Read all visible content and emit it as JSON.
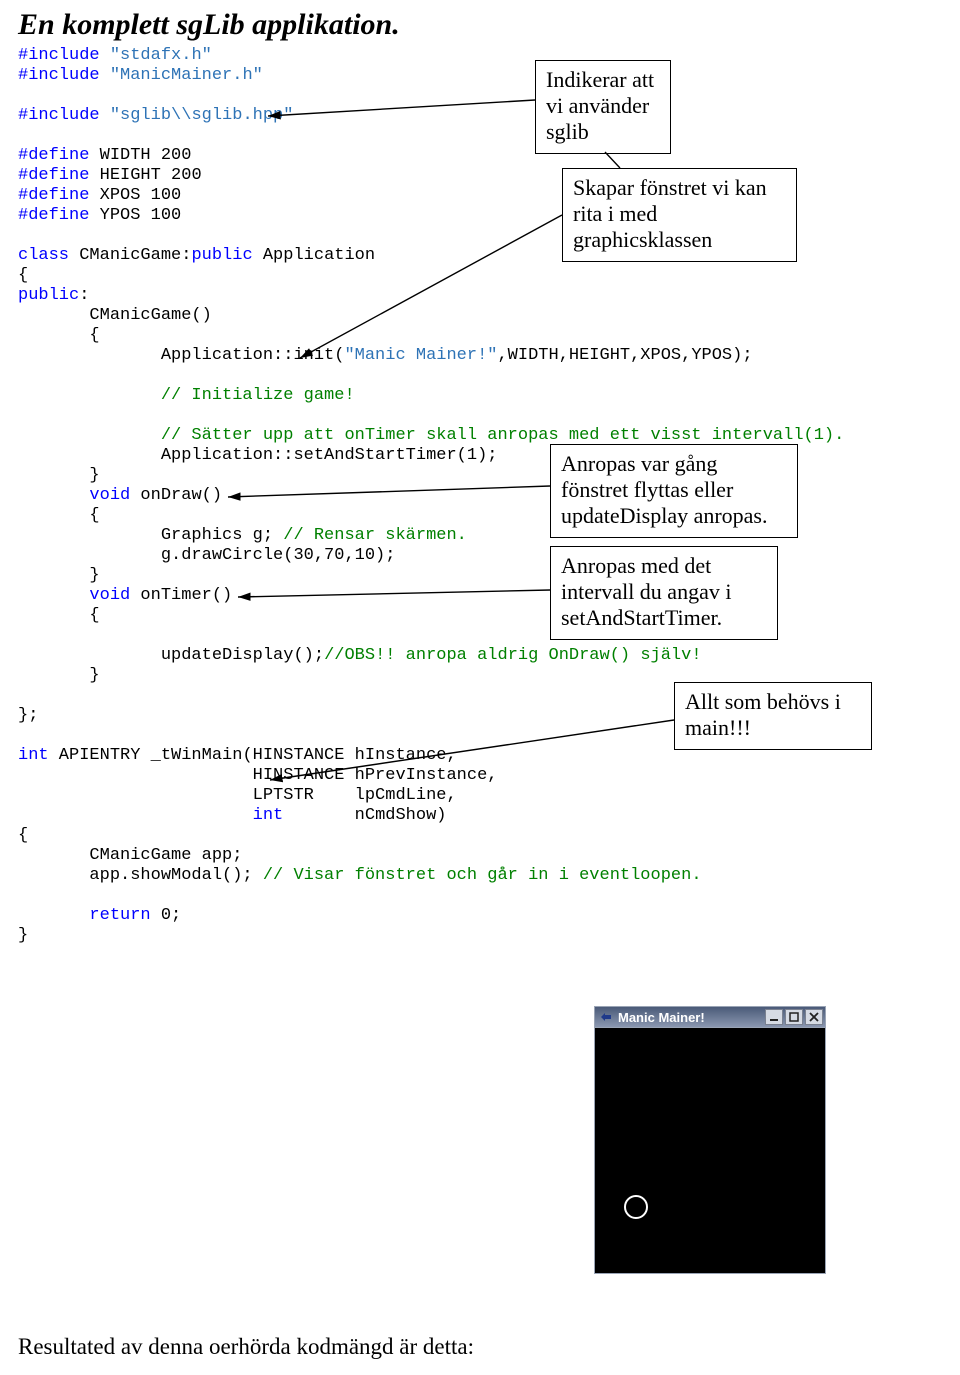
{
  "title": "En komplett sgLib applikation.",
  "code": {
    "l01a": "#include",
    "l01b": " \"stdafx.h\"",
    "l02a": "#include",
    "l02b": " \"ManicMainer.h\"",
    "l03": "",
    "l04a": "#include",
    "l04b": " \"sglib\\\\sglib.hpp\"",
    "l05": "",
    "l06a": "#define",
    "l06b": " WIDTH 200",
    "l07a": "#define",
    "l07b": " HEIGHT 200",
    "l08a": "#define",
    "l08b": " XPOS 100",
    "l09a": "#define",
    "l09b": " YPOS 100",
    "l10": "",
    "l11a": "class",
    "l11b": " CManicGame:",
    "l11c": "public",
    "l11d": " Application",
    "l12": "{",
    "l13a": "public",
    "l13b": ":",
    "l14": "       CManicGame()",
    "l15": "       {",
    "l16a": "              Application::init(",
    "l16b": "\"Manic Mainer!\"",
    "l16c": ",WIDTH,HEIGHT,XPOS,YPOS);",
    "l17": "",
    "l18": "              // Initialize game!",
    "l19": "",
    "l20": "              // Sätter upp att onTimer skall anropas med ett visst intervall(1).",
    "l21": "              Application::setAndStartTimer(1);",
    "l22": "       }",
    "l23a": "       ",
    "l23b": "void",
    "l23c": " onDraw()",
    "l24": "       {",
    "l25a": "              Graphics g; ",
    "l25b": "// Rensar skärmen.",
    "l26": "              g.drawCircle(30,70,10);",
    "l27": "       }",
    "l28a": "       ",
    "l28b": "void",
    "l28c": " onTimer()",
    "l29": "       {",
    "l30": "",
    "l31a": "              updateDisplay();",
    "l31b": "//OBS!! anropa aldrig OnDraw() själv!",
    "l32": "       }",
    "l33": "",
    "l34": "};",
    "l35": "",
    "l36a": "int",
    "l36b": " APIENTRY _tWinMain(HINSTANCE hInstance,",
    "l37": "                       HINSTANCE hPrevInstance,",
    "l38a": "                       LPTSTR    lpCmdLine,",
    "l39a": "                       ",
    "l39b": "int",
    "l39c": "       nCmdShow)",
    "l40": "{",
    "l41": "       CManicGame app;",
    "l42a": "       app.showModal(); ",
    "l42b": "// Visar fönstret och går in i eventloopen.",
    "l43": "",
    "l44a": "       ",
    "l44b": "return",
    "l44c": " 0;",
    "l45": "}"
  },
  "callouts": {
    "c1": "Indikerar att\nvi använder\nsglib",
    "c2": "Skapar fönstret vi kan\nrita i med\ngraphicsklassen",
    "c3": "Anropas var gång\nfönstret flyttas eller\nupdateDisplay anropas.",
    "c4": "Anropas med det\nintervall du angav i\nsetAndStartTimer.",
    "c5": "Allt som behövs i\nmain!!!"
  },
  "result_text": "Resultated av denna oerhörda kodmängd är detta:",
  "window": {
    "title": "Manic Mainer!"
  }
}
